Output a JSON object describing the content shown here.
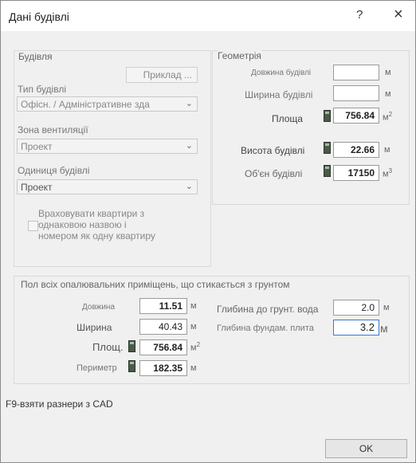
{
  "window": {
    "title": "Дані будівлі",
    "help_label": "?",
    "close_label": "×"
  },
  "building": {
    "group_label": "Будівля",
    "example_button": "Приклад ...",
    "type_label": "Тип будівлі",
    "type_value": "Офісн. / Адміністративне зда",
    "zone_label": "Зона вентиляції",
    "zone_value": "Проект",
    "unit_label": "Одиниця будівлі",
    "unit_value": "Проект",
    "apartments_text": [
      "Враховувати квартири з",
      "однаковою назвою і",
      "номером як одну квартиру"
    ],
    "apartments_checked": false
  },
  "geometry": {
    "group_label": "Геометрія",
    "length_label": "Довжина будівлі",
    "length_value": "",
    "length_unit": "м",
    "width_label": "Ширина будівлі",
    "width_value": "",
    "width_unit": "м",
    "area_label": "Площа",
    "area_value": "756.84",
    "area_unit": "м",
    "area_sup": "2",
    "height_label": "Висота будівлі",
    "height_value": "22.66",
    "height_unit": "м",
    "volume_label": "Об'єн будівлі",
    "volume_value": "17150",
    "volume_unit": "м",
    "volume_sup": "3"
  },
  "floor": {
    "group_label": "Пол всіх опалювальних приміщень, що стикається з грунтом",
    "length_label": "Довжина",
    "length_value": "11.51",
    "length_unit": "м",
    "width_label": "Ширина",
    "width_value": "40.43",
    "width_unit": "м",
    "area_label": "Площ.",
    "area_value": "756.84",
    "area_unit": "м",
    "area_sup": "2",
    "perimeter_label": "Периметр",
    "perimeter_value": "182.35",
    "perimeter_unit": "м",
    "groundwater_label": "Глибина до грунт. вода",
    "groundwater_value": "2.0",
    "groundwater_unit": "м",
    "foundation_label": "Глибина фундам. плита",
    "foundation_value": "3.2",
    "foundation_unit": "м"
  },
  "footer": {
    "hint": "F9-взяти разнери з CAD",
    "ok_label": "OK"
  }
}
